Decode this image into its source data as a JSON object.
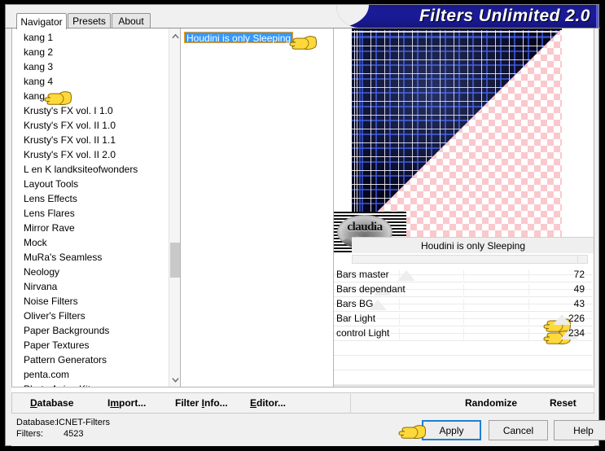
{
  "window": {
    "banner_title": "Filters Unlimited 2.0"
  },
  "tabs": [
    {
      "label": "Navigator",
      "active": true
    },
    {
      "label": "Presets",
      "active": false
    },
    {
      "label": "About",
      "active": false
    }
  ],
  "filter_list": {
    "items": [
      "kang 1",
      "kang 2",
      "kang 3",
      "kang 4",
      "kang",
      "Krusty's FX vol. I 1.0",
      "Krusty's FX vol. II 1.0",
      "Krusty's FX vol. II 1.1",
      "Krusty's FX vol. II 2.0",
      "L en K landksiteofwonders",
      "Layout Tools",
      "Lens Effects",
      "Lens Flares",
      "Mirror Rave",
      "Mock",
      "MuRa's Seamless",
      "Neology",
      "Nirvana",
      "Noise Filters",
      "Oliver's Filters",
      "Paper Backgrounds",
      "Paper Textures",
      "Pattern Generators",
      "penta.com",
      "Photo Aging Kit"
    ],
    "selected_index": 4,
    "scroll_up_icon": "chevron-up-icon",
    "scroll_down_icon": "chevron-down-icon"
  },
  "preset_list": {
    "items": [
      "Houdini is only Sleeping"
    ],
    "selected_index": 0,
    "highlight_color": "#3399ff",
    "highlight_border_color": "#ff9900"
  },
  "preview": {
    "caption": "Houdini is only Sleeping",
    "watermark": "claudia"
  },
  "sliders": [
    {
      "label": "Bars master",
      "value": "72",
      "percent": 28
    },
    {
      "label": "Bars dependant",
      "value": "49",
      "percent": 19
    },
    {
      "label": "Bars BG",
      "value": "43",
      "percent": 17
    },
    {
      "label": "Bar Light",
      "value": "226",
      "percent": 88
    },
    {
      "label": "control Light",
      "value": "234",
      "percent": 91
    }
  ],
  "linkbar": {
    "left_links": [
      {
        "pre": "",
        "accel": "D",
        "post": "atabase"
      },
      {
        "pre": "I",
        "accel": "m",
        "post": "port..."
      },
      {
        "pre": "Filter ",
        "accel": "I",
        "post": "nfo..."
      },
      {
        "pre": "",
        "accel": "E",
        "post": "ditor..."
      }
    ],
    "right_links": [
      {
        "pre": "Randomize",
        "accel": "",
        "post": ""
      },
      {
        "pre": "Reset",
        "accel": "",
        "post": ""
      }
    ]
  },
  "status": {
    "database_label": "Database:",
    "database_value": "ICNET-Filters",
    "filters_label": "Filters:",
    "filters_value": "4523"
  },
  "buttons": {
    "apply": "Apply",
    "cancel": "Cancel",
    "help": "Help",
    "apply_focus_color": "#1e7fd4"
  },
  "cursors": {
    "icon": "pointing-hand-cursor"
  }
}
